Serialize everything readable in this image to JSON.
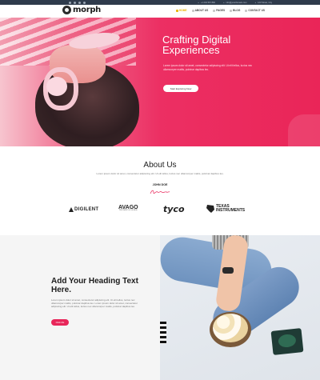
{
  "topbar": {
    "social_icons": [
      "facebook-icon",
      "twitter-icon",
      "linkedin-icon",
      "instagram-icon"
    ],
    "contact": [
      "+1 234 567 890",
      "info@yourdomain.com",
      "123 Street, City"
    ]
  },
  "nav": {
    "logo_text": "morph",
    "items": [
      {
        "label": "HOME",
        "active": true
      },
      {
        "label": "ABOUT US",
        "active": false
      },
      {
        "label": "PAGES",
        "active": false
      },
      {
        "label": "BLOG",
        "active": false
      },
      {
        "label": "CONTACT US",
        "active": false
      }
    ]
  },
  "hero": {
    "title_line1": "Crafting Digital",
    "title_line2": "Experiences",
    "text": "Lorem ipsum dolor sit amet, consectetur adipiscing elit. Ut elit tellus, luctus nec ullamcorper mattis, pulvinar dapibus leo.",
    "button_label": "Start Exploring Now"
  },
  "about": {
    "title": "About Us",
    "text": "Lorem ipsum dolor sit amet, consectetur adipiscing elit. Ut elit tellus, luctus nec ullamcorper mattis, pulvinar dapibus leo.",
    "name": "JOHN DOE"
  },
  "brands": {
    "digilent": "DIGILENT",
    "avago": "AVAGO",
    "avago_sub": "TECHNOLOGIES",
    "tyco": "tyco",
    "ti_line1": "TEXAS",
    "ti_line2": "INSTRUMENTS"
  },
  "feature": {
    "title": "Add Your Heading Text Here.",
    "text": "Lorem ipsum dolor sit amet, consectetur adipiscing elit. Ut elit tellus, luctus nec ullamcorper mattis, pulvinar dapibus leo. Lorem ipsum dolor sit amet, consectetur adipiscing elit. Ut elit tellus, luctus nec ullamcorper mattis, pulvinar dapibus leo.",
    "button_label": "Click Me"
  },
  "colors": {
    "accent": "#e8265a",
    "topbar": "#2f3b4c",
    "nav_active": "#e9b400"
  }
}
